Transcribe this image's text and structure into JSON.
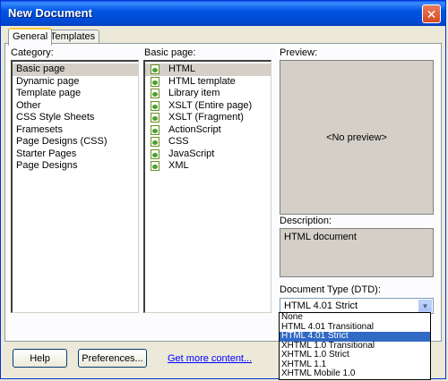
{
  "window": {
    "title": "New Document",
    "close_glyph": "✕"
  },
  "tabs": [
    "General",
    "Templates"
  ],
  "category": {
    "label": "Category:",
    "items": [
      "Basic page",
      "Dynamic page",
      "Template page",
      "Other",
      "CSS Style Sheets",
      "Framesets",
      "Page Designs (CSS)",
      "Starter Pages",
      "Page Designs"
    ],
    "selected": "Basic page"
  },
  "basic_page": {
    "label": "Basic page:",
    "items": [
      "HTML",
      "HTML template",
      "Library item",
      "XSLT (Entire page)",
      "XSLT (Fragment)",
      "ActionScript",
      "CSS",
      "JavaScript",
      "XML"
    ],
    "selected": "HTML",
    "icon": "document-icon"
  },
  "preview": {
    "label": "Preview:",
    "text": "<No preview>"
  },
  "description": {
    "label": "Description:",
    "text": "HTML document"
  },
  "doctype": {
    "label": "Document Type (DTD):",
    "value": "HTML 4.01 Strict",
    "arrow": "▼",
    "options": [
      "None",
      "HTML 4.01 Transitional",
      "HTML 4.01 Strict",
      "XHTML 1.0 Transitional",
      "XHTML 1.0 Strict",
      "XHTML 1.1",
      "XHTML Mobile 1.0"
    ],
    "highlighted": "HTML 4.01 Strict"
  },
  "buttons": {
    "help": "Help",
    "preferences": "Preferences...",
    "get_more": "Get more content..."
  },
  "colors": {
    "titlebar": "#0053e2",
    "highlight": "#316ac5",
    "link": "#0000ff"
  }
}
